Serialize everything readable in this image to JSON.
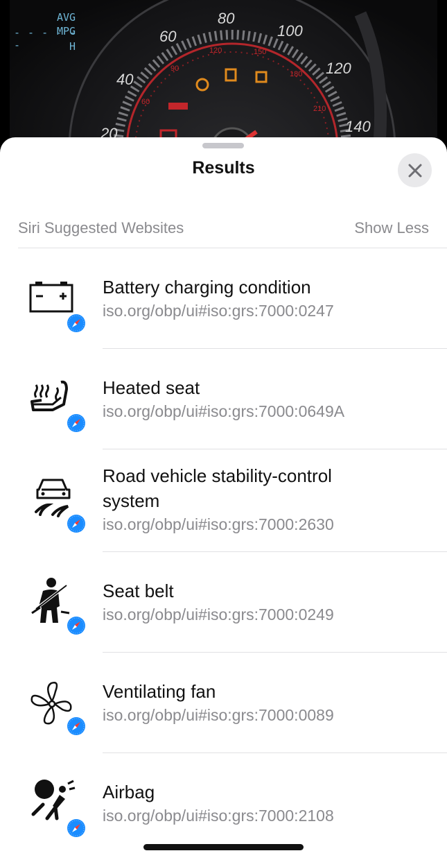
{
  "dashboard": {
    "lcd_avg": "AVG",
    "lcd_mpg": "MPG",
    "lcd_dashes": "- - -  - - -",
    "lcd_h": "H",
    "speeds": [
      "20",
      "40",
      "60",
      "80",
      "100",
      "120",
      "140"
    ],
    "kmh": [
      "60",
      "90",
      "120",
      "150",
      "180",
      "210"
    ]
  },
  "sheet": {
    "title": "Results",
    "section_title": "Siri Suggested Websites",
    "show_less": "Show Less"
  },
  "results": [
    {
      "title": "Battery charging condition",
      "url": "iso.org/obp/ui#iso:grs:7000:0247",
      "icon": "battery-icon"
    },
    {
      "title": "Heated seat",
      "url": "iso.org/obp/ui#iso:grs:7000:0649A",
      "icon": "heated-seat-icon"
    },
    {
      "title": "Road vehicle stability-control system",
      "url": "iso.org/obp/ui#iso:grs:7000:2630",
      "icon": "stability-control-icon"
    },
    {
      "title": "Seat belt",
      "url": "iso.org/obp/ui#iso:grs:7000:0249",
      "icon": "seat-belt-icon"
    },
    {
      "title": "Ventilating fan",
      "url": "iso.org/obp/ui#iso:grs:7000:0089",
      "icon": "fan-icon"
    },
    {
      "title": "Airbag",
      "url": "iso.org/obp/ui#iso:grs:7000:2108",
      "icon": "airbag-icon"
    }
  ],
  "colors": {
    "accent_blue": "#1a8cff",
    "secondary_text": "#8a8a8e",
    "separator": "#e1e1e3"
  }
}
